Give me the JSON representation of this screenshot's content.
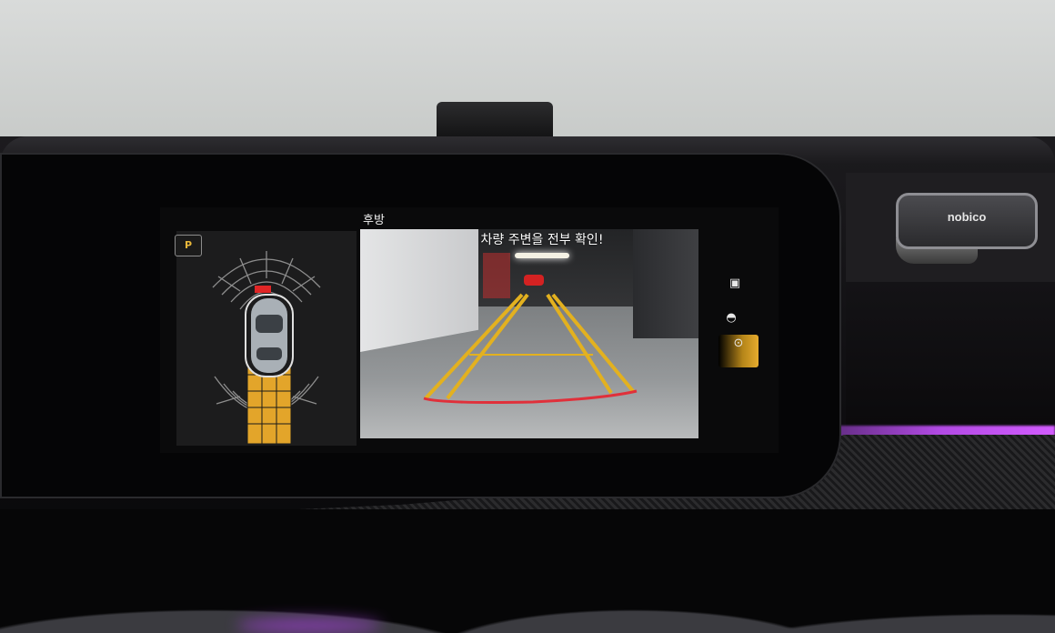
{
  "screen": {
    "view_title": "후방",
    "warning": "차량 주변을 전부 확인!",
    "park_badge": "P",
    "side_icons": [
      "camera-view-icon",
      "parking-sensor-icon",
      "top-view-icon"
    ]
  },
  "holder": {
    "brand": "nobico"
  },
  "colors": {
    "guide_line": "#e3b11f",
    "warning_line": "#e0303a",
    "active_tab": "#e6ab2e",
    "ambient": "#c24df0"
  }
}
